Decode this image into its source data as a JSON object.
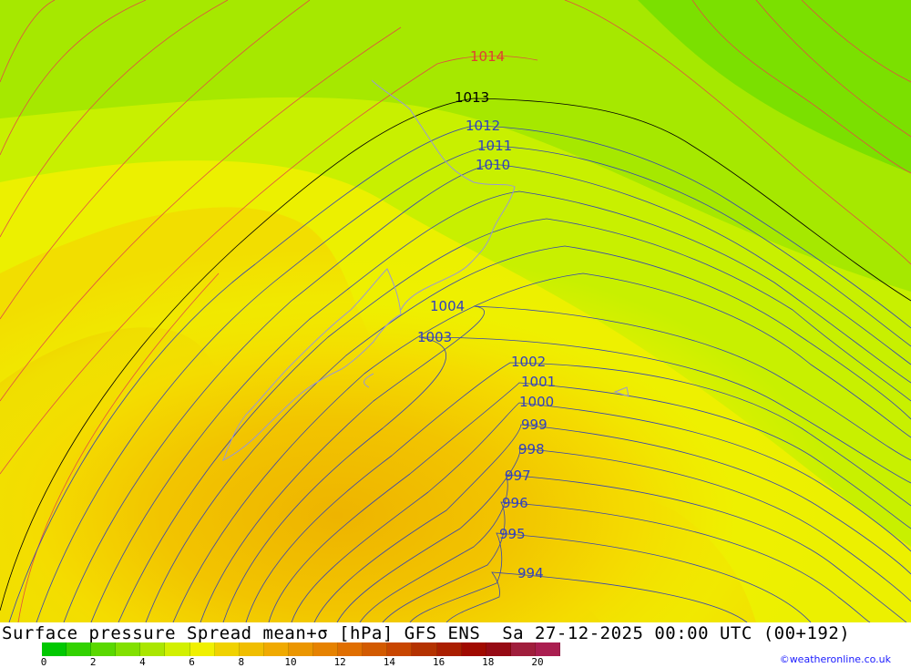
{
  "map": {
    "contour_labels": [
      {
        "text": "1014",
        "color": "#e04030"
      },
      {
        "text": "1013",
        "color": "#000000"
      },
      {
        "text": "1012",
        "color": "#3040c0"
      },
      {
        "text": "1011",
        "color": "#3040c0"
      },
      {
        "text": "1010",
        "color": "#3040c0"
      },
      {
        "text": "1004",
        "color": "#3040c0"
      },
      {
        "text": "1003",
        "color": "#3040c0"
      },
      {
        "text": "1002",
        "color": "#3040c0"
      },
      {
        "text": "1001",
        "color": "#3040c0"
      },
      {
        "text": "1000",
        "color": "#3040c0"
      },
      {
        "text": "999",
        "color": "#3040c0"
      },
      {
        "text": "998",
        "color": "#3040c0"
      },
      {
        "text": "997",
        "color": "#3040c0"
      },
      {
        "text": "996",
        "color": "#3040c0"
      },
      {
        "text": "995",
        "color": "#3040c0"
      },
      {
        "text": "994",
        "color": "#3040c0"
      }
    ]
  },
  "footer": {
    "title": "Surface pressure Spread mean+σ [hPa] GFS ENS  Sa 27-12-2025 00:00 UTC (00+192)",
    "credit": "©weatheronline.co.uk",
    "colorbar_colors": [
      "#00c800",
      "#32d200",
      "#5ad800",
      "#82e000",
      "#aae600",
      "#d2f000",
      "#f0f000",
      "#f0d200",
      "#f0be00",
      "#f0aa00",
      "#eb9600",
      "#e68200",
      "#e06e00",
      "#d25a00",
      "#c84600",
      "#b43200",
      "#aa1e00",
      "#a00a00",
      "#960a14",
      "#a01e3c",
      "#aa1e50"
    ],
    "tick_labels": [
      "0",
      "2",
      "4",
      "6",
      "8",
      "10",
      "12",
      "14",
      "16",
      "18",
      "20"
    ]
  }
}
